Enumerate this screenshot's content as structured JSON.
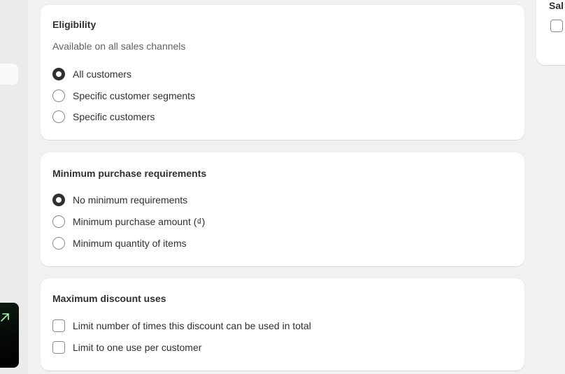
{
  "eligibility": {
    "title": "Eligibility",
    "subtitle": "Available on all sales channels",
    "options": [
      {
        "label": "All customers",
        "selected": true
      },
      {
        "label": "Specific customer segments",
        "selected": false
      },
      {
        "label": "Specific customers",
        "selected": false
      }
    ]
  },
  "minimum_requirements": {
    "title": "Minimum purchase requirements",
    "options": [
      {
        "label": "No minimum requirements",
        "selected": true
      },
      {
        "label": "Minimum purchase amount (₫)",
        "selected": false
      },
      {
        "label": "Minimum quantity of items",
        "selected": false
      }
    ]
  },
  "maximum_uses": {
    "title": "Maximum discount uses",
    "options": [
      {
        "label": "Limit number of times this discount can be used in total",
        "checked": false
      },
      {
        "label": "Limit to one use per customer",
        "checked": false
      }
    ]
  },
  "right_panel": {
    "title": "Sal"
  },
  "colors": {
    "background": "#f1f1f1",
    "card": "#ffffff",
    "text": "#303030",
    "subtext": "#616161",
    "promo": "#000000"
  },
  "icons": {
    "promo": "arrow-up-right-icon"
  }
}
